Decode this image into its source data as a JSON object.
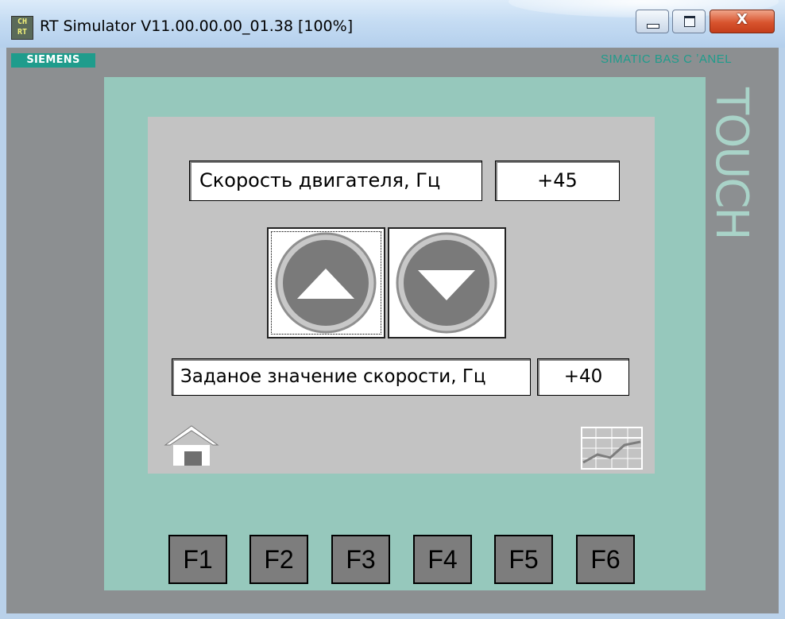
{
  "window": {
    "title": "RT Simulator V11.00.00.00_01.38 [100%]",
    "icon_text": "CH RT",
    "close_glyph": "X"
  },
  "panel": {
    "brand": "SIEMENS",
    "model": "SIMATIC BAS C ʼANEL",
    "touch_text": "TOUCH"
  },
  "screen": {
    "motor_speed_label": "Скорость двигателя, Гц",
    "motor_speed_value": "+45",
    "setpoint_label": "Заданое значение скорости, Гц",
    "setpoint_value": "+40"
  },
  "function_keys": [
    "F1",
    "F2",
    "F3",
    "F4",
    "F5",
    "F6"
  ],
  "colors": {
    "bezel": "#96c8bc",
    "screen": "#c3c3c3",
    "brand": "#1f9c8c"
  }
}
